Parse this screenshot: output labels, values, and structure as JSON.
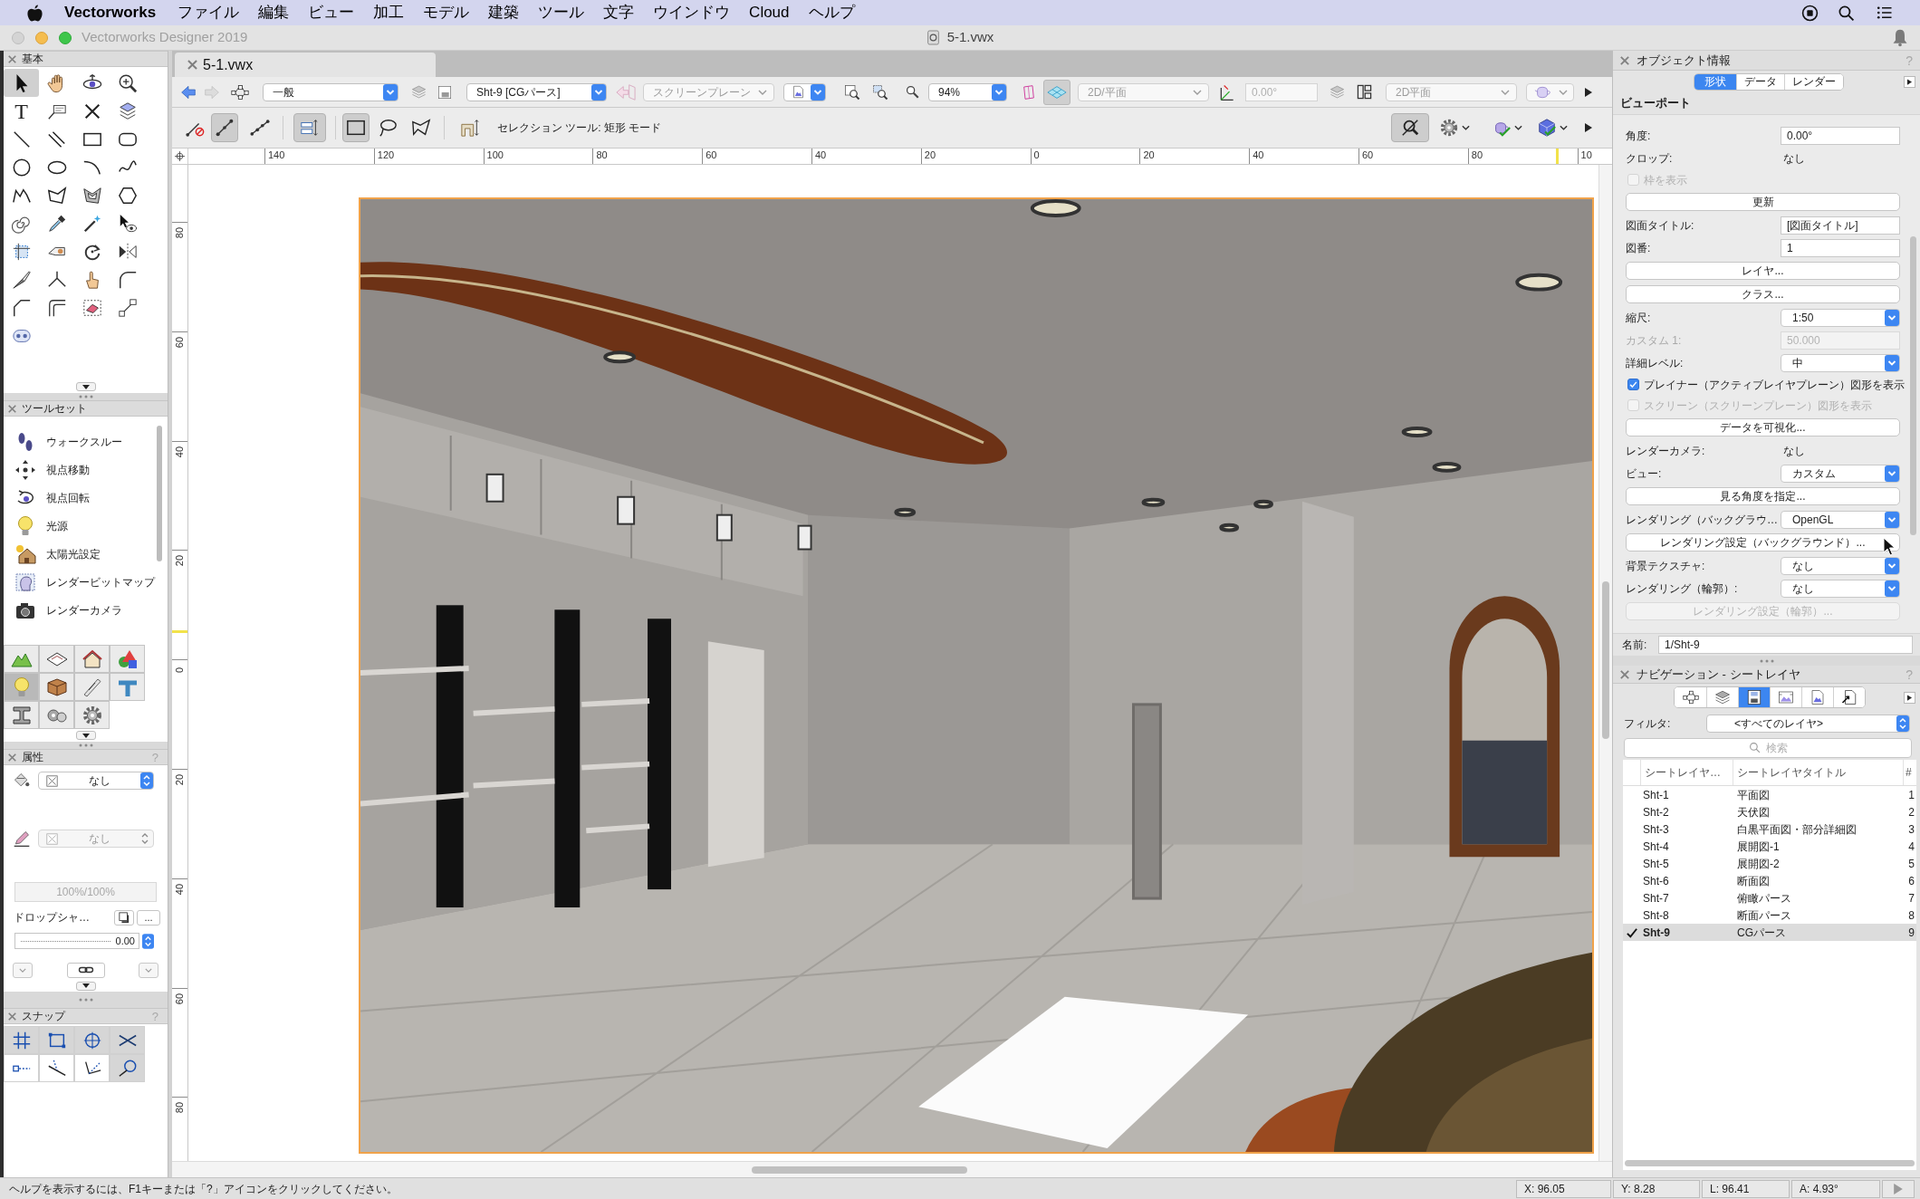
{
  "menu_bar": {
    "app_name": "Vectorworks",
    "menus": [
      "ファイル",
      "編集",
      "ビュー",
      "加工",
      "モデル",
      "建築",
      "ツール",
      "文字",
      "ウインドウ",
      "Cloud",
      "ヘルプ"
    ]
  },
  "window": {
    "title": "Vectorworks Designer 2019",
    "document_title": "5-1.vwx"
  },
  "document_tabs": [
    {
      "label": "5-1.vwx",
      "selected": true
    }
  ],
  "view_bar": {
    "class_menu": {
      "value": "一般",
      "disabled": false
    },
    "layer_menu": {
      "value": "Sht-9 [CGパース]",
      "disabled": false
    },
    "plane_menu": {
      "value": "スクリーンプレーン",
      "disabled": true
    },
    "zoom_menu": {
      "value": "94%",
      "disabled": false
    },
    "view_menu": {
      "value": "2D/平面",
      "disabled": true
    },
    "rotation_field": {
      "value": "0.00°",
      "disabled": true
    },
    "render_menu": {
      "value": "2D平面",
      "disabled": true
    }
  },
  "mode_bar": {
    "groups": [
      [
        {
          "selected": false
        },
        {
          "selected": true
        },
        {
          "selected": false
        }
      ],
      [
        {
          "selected": true
        }
      ],
      [
        {
          "selected": true
        },
        {
          "selected": false
        },
        {
          "selected": false
        }
      ],
      [
        {
          "selected": false
        }
      ]
    ],
    "hint": "セレクション ツール: 矩形 モード",
    "view_tools": [
      {
        "selected": true
      },
      {
        "selected": false
      },
      {
        "selected": false
      },
      {
        "selected": false
      }
    ]
  },
  "rulers": {
    "horizontal": [
      "140",
      "120",
      "100",
      "80",
      "60",
      "40",
      "20",
      "0",
      "20",
      "40",
      "60",
      "80",
      "10"
    ],
    "vertical": [
      "80",
      "60",
      "40",
      "20",
      "0",
      "20",
      "40",
      "60",
      "80"
    ]
  },
  "basic_palette": {
    "title": "基本",
    "tools": [
      {
        "selected": true
      },
      {
        "selected": false
      },
      {
        "selected": false
      },
      {
        "selected": false
      },
      {
        "glyph": "T",
        "selected": false
      },
      {
        "selected": false
      },
      {
        "selected": false
      },
      {
        "selected": false
      },
      {
        "selected": false
      },
      {
        "selected": false
      },
      {
        "selected": false
      },
      {
        "selected": false
      },
      {
        "selected": false
      },
      {
        "selected": false
      },
      {
        "selected": false
      },
      {
        "selected": false
      },
      {
        "selected": false
      },
      {
        "selected": false
      },
      {
        "selected": false
      },
      {
        "selected": false
      },
      {
        "selected": false
      },
      {
        "selected": false
      },
      {
        "selected": false
      },
      {
        "selected": false
      },
      {
        "selected": false
      },
      {
        "selected": false
      },
      {
        "selected": false
      },
      {
        "selected": false
      },
      {
        "selected": false
      },
      {
        "selected": false
      },
      {
        "selected": false
      },
      {
        "selected": false
      },
      {
        "selected": false
      },
      {
        "selected": false
      },
      {
        "selected": false
      },
      {
        "selected": false
      },
      {
        "selected": false
      }
    ]
  },
  "toolset_palette": {
    "title": "ツールセット",
    "tools": [
      {
        "label": "ウォークスルー"
      },
      {
        "label": "視点移動"
      },
      {
        "label": "視点回転"
      },
      {
        "label": "光源"
      },
      {
        "label": "太陽光設定"
      },
      {
        "label": "レンダービットマップ"
      },
      {
        "label": "レンダーカメラ"
      }
    ],
    "sets": [
      {
        "selected": false
      },
      {
        "selected": false
      },
      {
        "selected": false
      },
      {
        "selected": false
      },
      {
        "selected": true
      },
      {
        "selected": false
      },
      {
        "selected": false
      },
      {
        "selected": false
      },
      {
        "selected": false
      },
      {
        "selected": false
      },
      {
        "selected": false
      }
    ]
  },
  "attributes_palette": {
    "title": "属性",
    "help": "?",
    "fill": {
      "value": "なし",
      "disabled": false
    },
    "pen": {
      "value": "なし",
      "disabled": true
    },
    "opacity": {
      "value": "100%/100%",
      "disabled": true
    },
    "drop_shadow_label": "ドロップシャ…",
    "more_button": "...",
    "amount": "0.00"
  },
  "snap_palette": {
    "title": "スナップ",
    "help": "?",
    "snaps": [
      {
        "on": true
      },
      {
        "on": true
      },
      {
        "on": true
      },
      {
        "on": true
      },
      {
        "on": false
      },
      {
        "on": false
      },
      {
        "on": false
      },
      {
        "on": true
      }
    ]
  },
  "object_info": {
    "title": "オブジェクト情報",
    "help": "?",
    "tabs": [
      {
        "label": "形状",
        "selected": true
      },
      {
        "label": "データ",
        "selected": false
      },
      {
        "label": "レンダー",
        "selected": false
      }
    ],
    "heading": "ビューポート",
    "rows": [
      {
        "kind": "field",
        "label": "角度:",
        "value": "0.00°",
        "disabled": false
      },
      {
        "kind": "text",
        "label": "クロップ:",
        "value": "なし",
        "disabled": false
      },
      {
        "kind": "checkbox",
        "label": "枠を表示",
        "checked": false,
        "disabled": true
      },
      {
        "kind": "button",
        "label": "更新",
        "disabled": false
      },
      {
        "kind": "field",
        "label": "図面タイトル:",
        "value": "[図面タイトル]",
        "disabled": false
      },
      {
        "kind": "field",
        "label": "図番:",
        "value": "1",
        "disabled": false
      },
      {
        "kind": "button",
        "label": "レイヤ...",
        "disabled": false
      },
      {
        "kind": "button",
        "label": "クラス...",
        "disabled": false
      },
      {
        "kind": "dropdown",
        "label": "縮尺:",
        "value": "1:50",
        "disabled": false
      },
      {
        "kind": "field",
        "label": "カスタム 1:",
        "value": "50.000",
        "disabled": true
      },
      {
        "kind": "dropdown",
        "label": "詳細レベル:",
        "value": "中",
        "disabled": false
      },
      {
        "kind": "checkbox",
        "label": "プレイナー（アクティブレイヤプレーン）図形を表示",
        "checked": true,
        "disabled": false
      },
      {
        "kind": "checkbox",
        "label": "スクリーン（スクリーンプレーン）図形を表示",
        "checked": false,
        "disabled": true
      },
      {
        "kind": "button",
        "label": "データを可視化...",
        "disabled": false
      },
      {
        "kind": "text",
        "label": "レンダーカメラ:",
        "value": "なし",
        "disabled": false
      },
      {
        "kind": "dropdown",
        "label": "ビュー:",
        "value": "カスタム",
        "disabled": false
      },
      {
        "kind": "button",
        "label": "見る角度を指定...",
        "disabled": false
      },
      {
        "kind": "dropdown",
        "label": "レンダリング（バックグラウ…",
        "value": "OpenGL",
        "disabled": false
      },
      {
        "kind": "button",
        "label": "レンダリング設定（バックグラウンド）...",
        "disabled": false
      },
      {
        "kind": "dropdown",
        "label": "背景テクスチャ:",
        "value": "なし",
        "disabled": false
      },
      {
        "kind": "dropdown",
        "label": "レンダリング（輪郭）:",
        "value": "なし",
        "disabled": false
      },
      {
        "kind": "button",
        "label": "レンダリング設定（輪郭）...",
        "disabled": true
      }
    ],
    "name_label": "名前:",
    "name": "1/Sht-9"
  },
  "navigation": {
    "title": "ナビゲーション - シートレイヤ",
    "help": "?",
    "views": [
      {
        "selected": false
      },
      {
        "selected": false
      },
      {
        "selected": true
      },
      {
        "selected": false
      },
      {
        "selected": false
      },
      {
        "selected": false
      }
    ],
    "filter_label": "フィルタ:",
    "filter": "<すべてのレイヤ>",
    "search_placeholder": "検索",
    "columns": [
      "シートレイヤ…",
      "シートレイヤタイトル",
      "#"
    ],
    "rows": [
      {
        "name": "Sht-1",
        "title": "平面図",
        "number": "1",
        "selected": false
      },
      {
        "name": "Sht-2",
        "title": "天伏図",
        "number": "2",
        "selected": false
      },
      {
        "name": "Sht-3",
        "title": "白黒平面図・部分詳細図",
        "number": "3",
        "selected": false
      },
      {
        "name": "Sht-4",
        "title": "展開図-1",
        "number": "4",
        "selected": false
      },
      {
        "name": "Sht-5",
        "title": "展開図-2",
        "number": "5",
        "selected": false
      },
      {
        "name": "Sht-6",
        "title": "断面図",
        "number": "6",
        "selected": false
      },
      {
        "name": "Sht-7",
        "title": "俯瞰パース",
        "number": "7",
        "selected": false
      },
      {
        "name": "Sht-8",
        "title": "断面パース",
        "number": "8",
        "selected": false
      },
      {
        "name": "Sht-9",
        "title": "CGパース",
        "number": "9",
        "selected": true
      }
    ]
  },
  "status_bar": {
    "help": "ヘルプを表示するには、F1キーまたは「?」アイコンをクリックしてください。",
    "x": "X: 96.05",
    "y": "Y: 8.28",
    "l": "L: 96.41",
    "a": "A: 4.93°"
  }
}
